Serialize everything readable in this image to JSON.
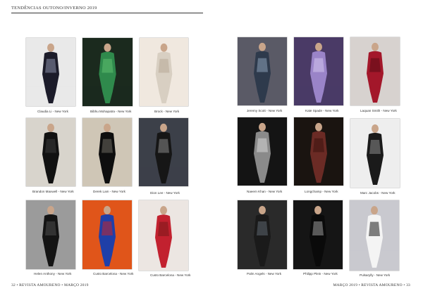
{
  "header": {
    "title": "TENDÊNCIAS OUTONO/INVERNO 2019"
  },
  "footer": {
    "left": "32 • REVISTA AMOURENO • MARÇO 2019",
    "right": "MARÇO 2019 • REVISTA AMOURENO • 33"
  },
  "looks": [
    {
      "caption": "Claudia Li - New York",
      "bg": "#e9e9e9",
      "fig": "#1c1c2a",
      "accent": "#8a8fa8"
    },
    {
      "caption": "Bibhu Mohapatra - New York",
      "bg": "#1b2a1e",
      "fig": "#2f8a4c",
      "accent": "#5fbf6f"
    },
    {
      "caption": "Brock - New York",
      "bg": "#f0e8df",
      "fig": "#d8cfc2",
      "accent": "#b8aa98"
    },
    {
      "caption": "Brandon Maxwell - New York",
      "bg": "#d8d4cc",
      "fig": "#111111",
      "accent": "#3a3a3a"
    },
    {
      "caption": "Derek Lam - New York",
      "bg": "#cfc6b6",
      "fig": "#0e0e0e",
      "accent": "#6d6a60"
    },
    {
      "caption": "Dion Lee - New York",
      "bg": "#3c4049",
      "fig": "#161616",
      "accent": "#888888"
    },
    {
      "caption": "Helen Anthony - New York",
      "bg": "#9b9b9b",
      "fig": "#141414",
      "accent": "#4a4a4a"
    },
    {
      "caption": "Custo Barcelona - New York",
      "bg": "#e0551a",
      "fig": "#1f3fa8",
      "accent": "#c2272d"
    },
    {
      "caption": "Custo Barcelona - New York",
      "bg": "#ece6e2",
      "fig": "#c2212f",
      "accent": "#7a1a1a"
    },
    {
      "caption": "Jeremy Scott - New York",
      "bg": "#5a5a66",
      "fig": "#2e3a4c",
      "accent": "#8da0b8"
    },
    {
      "caption": "Kate Spade - New York",
      "bg": "#4a3a66",
      "fig": "#9a84c8",
      "accent": "#d4c6ee"
    },
    {
      "caption": "Laquan Smith - New York",
      "bg": "#d7d2cf",
      "fig": "#a3172a",
      "accent": "#5a0b14"
    },
    {
      "caption": "Naeem Khan - New York",
      "bg": "#141414",
      "fig": "#8a8a8a",
      "accent": "#d6d6d6"
    },
    {
      "caption": "Longchamp - New York",
      "bg": "#1a1410",
      "fig": "#6b2b25",
      "accent": "#3a120e"
    },
    {
      "caption": "Marc Jacobs - New York",
      "bg": "#eeeeee",
      "fig": "#1a1a1a",
      "accent": "#8a8a8a"
    },
    {
      "caption": "Palm Angels - New York",
      "bg": "#2a2a2a",
      "fig": "#1a1a1a",
      "accent": "#5c6670"
    },
    {
      "caption": "Philipp Plein - New York",
      "bg": "#151515",
      "fig": "#0a0a0a",
      "accent": "#9a9a9a"
    },
    {
      "caption": "Pulsarylly - New York",
      "bg": "#c9c9cf",
      "fig": "#f4f4f4",
      "accent": "#1c1c1c"
    }
  ]
}
